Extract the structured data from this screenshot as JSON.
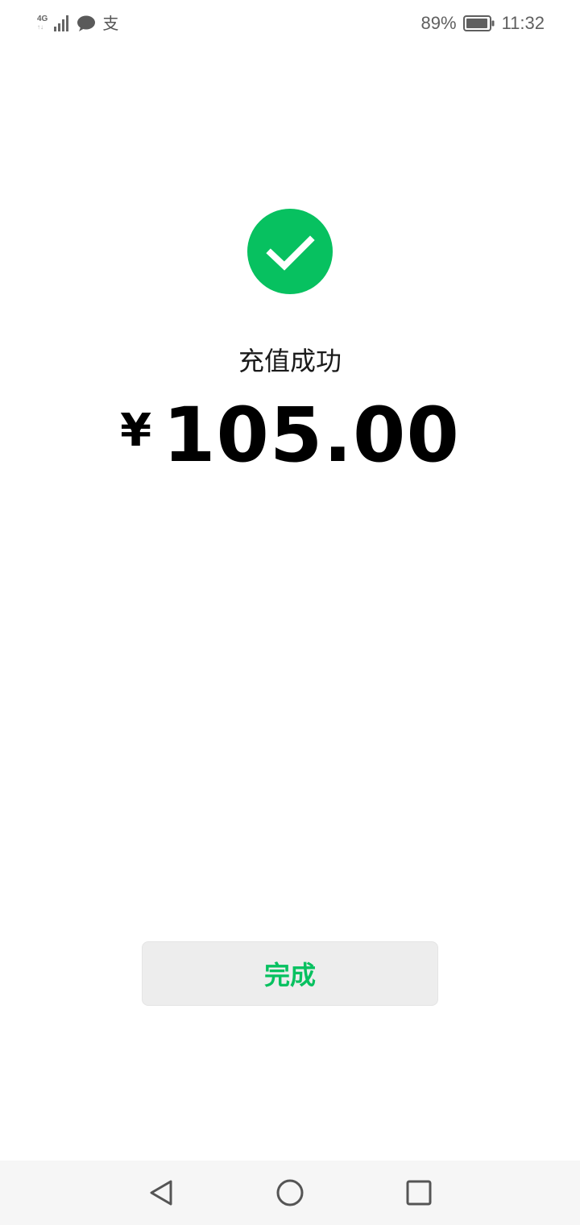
{
  "status_bar": {
    "network_label": "4G",
    "network_sub": "↑↓",
    "alipay_glyph": "支",
    "battery_percent": "89%",
    "time": "11:32"
  },
  "result": {
    "title": "充值成功",
    "currency_symbol": "¥",
    "amount": "105.00"
  },
  "actions": {
    "done_label": "完成"
  },
  "colors": {
    "accent_green": "#07c160",
    "button_bg": "#ededed",
    "nav_bg": "#f6f6f6"
  },
  "icons": {
    "success": "check-circle-icon",
    "back": "nav-back-icon",
    "home": "nav-home-icon",
    "recent": "nav-recent-icon"
  }
}
